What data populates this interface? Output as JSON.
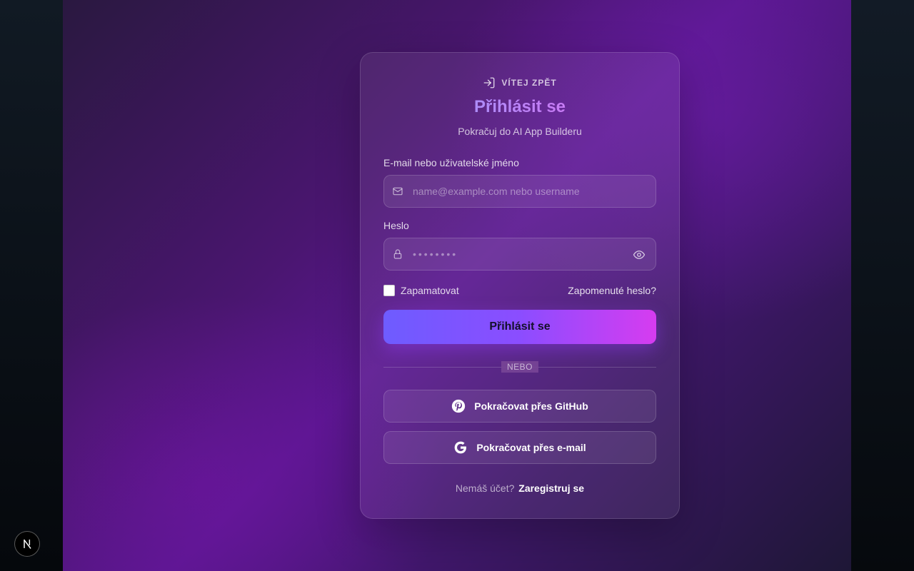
{
  "card": {
    "eyebrow": "VÍTEJ ZPĚT",
    "title": "Přihlásit se",
    "subtitle": "Pokračuj do AI App Builderu"
  },
  "form": {
    "identifier": {
      "label": "E-mail nebo uživatelské jméno",
      "placeholder": "name@example.com nebo username",
      "value": ""
    },
    "password": {
      "label": "Heslo",
      "placeholder": "••••••••",
      "value": ""
    },
    "remember_label": "Zapamatovat",
    "remember_checked": false,
    "forgot_label": "Zapomenuté heslo?",
    "submit_label": "Přihlásit se"
  },
  "divider_label": "NEBO",
  "social": {
    "github_label": "Pokračovat přes GitHub",
    "email_label": "Pokračovat přes e-mail"
  },
  "footer": {
    "prompt": "Nemáš účet?",
    "register_label": "Zaregistruj se"
  },
  "colors": {
    "accent_start": "#6e5cff",
    "accent_end": "#d63cf0",
    "title_gradient_start": "#8aa4ff",
    "title_gradient_end": "#e070f0"
  },
  "icons": {
    "eyebrow": "log-in-icon",
    "identifier": "mail-icon",
    "password": "lock-icon",
    "reveal": "eye-icon",
    "github": "pinterest-style-icon",
    "email": "google-g-icon",
    "badge": "next-logo-icon"
  }
}
